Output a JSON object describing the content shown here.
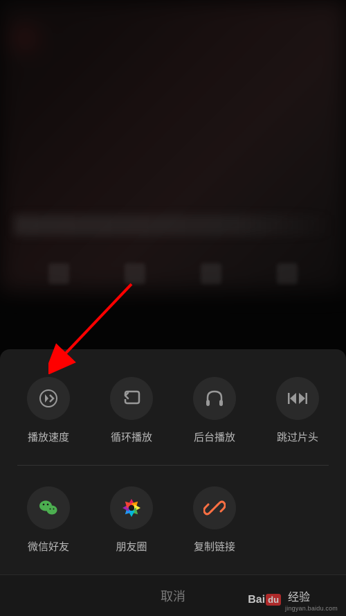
{
  "options_row1": [
    {
      "label": "播放速度",
      "icon": "speed-icon"
    },
    {
      "label": "循环播放",
      "icon": "loop-icon"
    },
    {
      "label": "后台播放",
      "icon": "headphones-icon"
    },
    {
      "label": "跳过片头",
      "icon": "skip-icon"
    }
  ],
  "share_row": [
    {
      "label": "微信好友",
      "icon": "wechat-icon"
    },
    {
      "label": "朋友圈",
      "icon": "moments-icon"
    },
    {
      "label": "复制链接",
      "icon": "link-icon"
    }
  ],
  "cancel_label": "取消",
  "watermark": {
    "brand_bai": "Bai",
    "brand_du": "du",
    "brand_jingyan": "经验",
    "url": "jingyan.baidu.com"
  }
}
